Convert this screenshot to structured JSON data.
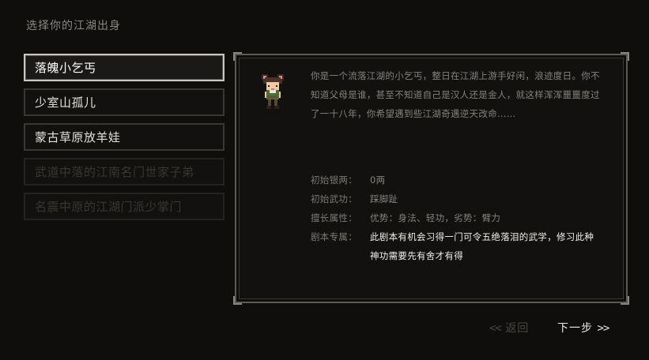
{
  "page": {
    "title": "选择你的江湖出身"
  },
  "origins": [
    {
      "label": "落魄小乞丐",
      "state": "selected"
    },
    {
      "label": "少室山孤儿",
      "state": "normal"
    },
    {
      "label": "蒙古草原放羊娃",
      "state": "normal"
    },
    {
      "label": "武道中落的江南名门世家子弟",
      "state": "locked"
    },
    {
      "label": "名震中原的江湖门派少掌门",
      "state": "locked"
    }
  ],
  "detail": {
    "portrait_icon": "beggar-girl-pixel-sprite",
    "description": "你是一个流落江湖的小乞丐，整日在江湖上游手好闲，浪迹度日。你不知道父母是谁，甚至不知道自己是汉人还是金人，就这样浑浑噩噩度过了一十八年，你希望遇到些江湖奇遇逆天改命……",
    "stats": [
      {
        "label": "初始银两：",
        "value": "0两"
      },
      {
        "label": "初始武功：",
        "value": "踩脚趾"
      },
      {
        "label": "擅长属性：",
        "value": "优势：身法、轻功，劣势：臂力"
      }
    ],
    "special": {
      "label": "剧本专属：",
      "value": "此剧本有机会习得一门可令五绝落泪的武学，修习此种神功需要先有舍才有得"
    }
  },
  "nav": {
    "back_arrow": "<<",
    "back_label": "返回",
    "next_label": "下一步",
    "next_arrow": ">>"
  },
  "colors": {
    "background": "#0f0e0d",
    "selected_border": "#c9c6c0",
    "text_primary": "#e4e2dd",
    "text_muted": "#85827c"
  }
}
